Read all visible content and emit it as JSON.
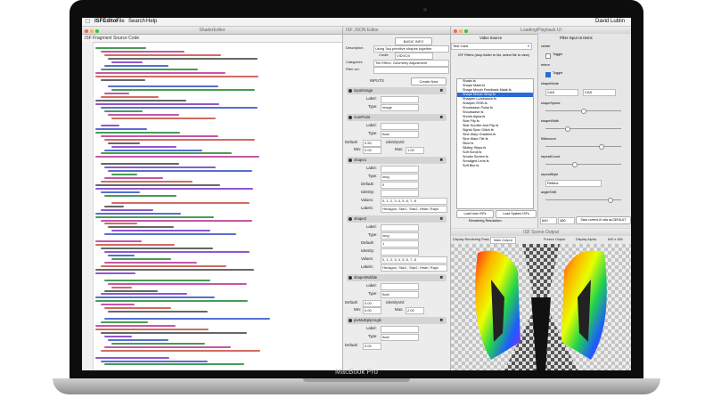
{
  "device": {
    "brand_label": "MacBook Pro"
  },
  "menubar": {
    "app": "ISFEditor",
    "items": [
      "File",
      "Search",
      "Help"
    ],
    "clock": "David Lublin"
  },
  "editor": {
    "window_title": "ShaderEditor",
    "header": "ISF Fragment Source Code"
  },
  "json_editor": {
    "header": "ISF JSON Editor",
    "basic_info_label": "BASIC INFO",
    "description_label": "Description:",
    "description_value": "Using 3sq primitive shapes together",
    "credit_label": "Credit:",
    "credit_value": "VIDVOX",
    "categories_label": "Categories:",
    "categories_value": "Tile Effect, Geometry Adjustment",
    "filter_version_label": "Filter ver:",
    "inputs_label": "INPUTS",
    "create_new_label": "Create New",
    "inputs": [
      {
        "name": "inputImage",
        "label_key": "Label:",
        "type_key": "Type:",
        "type_value": "image"
      },
      {
        "name": "numPoint",
        "label_key": "Label:",
        "type_key": "Type:",
        "type_value": "float",
        "default_key": "Default:",
        "default_value": "0.50",
        "min_key": "Min:",
        "min_value": "0.00",
        "max_key": "Max:",
        "max_value": "1.00",
        "identity_key": "IdentityVal:"
      },
      {
        "name": "shape1",
        "label_key": "Label:",
        "type_key": "Type:",
        "type_value": "long",
        "default_key": "Default:",
        "default_value": "0",
        "identity_key": "Identity:",
        "values_key": "Values:",
        "values_value": "0, 1, 2, 3, 4, 5, 6, 7, 8",
        "labels_key": "Labels:",
        "labels_value": "Hexagon, Star1, Star2, Heart, Rays"
      },
      {
        "name": "shape2",
        "label_key": "Label:",
        "type_key": "Type:",
        "type_value": "long",
        "default_key": "Default:",
        "default_value": "1",
        "identity_key": "Identity:",
        "values_key": "Values:",
        "values_value": "0, 1, 2, 3, 4, 5, 6, 7, 8",
        "labels_key": "Labels:",
        "labels_value": "Hexagon, Star1, Star2, Heart, Rays"
      },
      {
        "name": "shapeWobble",
        "label_key": "Label:",
        "type_key": "Type:",
        "type_value": "float",
        "default_key": "Default:",
        "default_value": "0.00",
        "min_key": "Min:",
        "min_value": "0.00",
        "max_key": "Max:",
        "max_value": "2.00",
        "identity_key": "IdentityVal:"
      },
      {
        "name": "pixMultiplyAngle",
        "label_key": "Label:",
        "type_key": "Type:",
        "type_value": "float",
        "default_key": "Default:",
        "default_value": "0.00"
      }
    ]
  },
  "loading": {
    "window_title": "Loading/Playback UI",
    "source_label": "Video Source",
    "source_select": "Test Card",
    "filter_ui_label": "Filter Input UI Items",
    "instructions": "ISF Filters (drop folder to list, select file to view)",
    "files": [
      "Shake.fs",
      "Shape Mask.fs",
      "Shape Morph Feedback Mask.fs",
      "Shape Morph Wrap.fs",
      "Sharpen Luminance.fs",
      "Sharpen RGB.fs",
      "Shockwave Pulse.fs",
      "Shockwave.fs",
      "Shrink Alpha.fs",
      "Side Flip.fs",
      "Side Scroller And Flip.fs",
      "Signal Sync Glitch.fs",
      "Sine Warp Gradient.fs",
      "Sine Warp Tile.fs",
      "Slice.fs",
      "Sliding Strips.fs",
      "Soft Scroll.fs",
      "Smoke Screen.fs",
      "Smudged Lens.fs",
      "Soft Blur.fs"
    ],
    "selected_index": 3,
    "load_user_label": "Load User ISFs",
    "load_system_label": "Load System ISFs",
    "rendering_resolution_label": "Rendering Resolution:",
    "res_w": "640",
    "res_h": "480",
    "save_default_label": "Save current UI vals as DEFAULT",
    "controls": [
      {
        "name": "center"
      },
      {
        "name": "Toggle",
        "kind": "checkbox"
      },
      {
        "name": "mirror"
      },
      {
        "name": "Toggle",
        "kind": "checkbox"
      },
      {
        "name": "shapeMode",
        "value": "CAS"
      },
      {
        "name": "shapeSpeed",
        "value": ""
      },
      {
        "name": "shapeWidth",
        "value": ""
      },
      {
        "name": "fillAmount",
        "value": ""
      },
      {
        "name": "repeatCount",
        "value": ""
      },
      {
        "name": "repeatStyle",
        "value": "Reflect"
      },
      {
        "name": "angleShift",
        "value": ""
      }
    ]
  },
  "output": {
    "window_title": "ISF Scene Output",
    "display_label": "Display Rendering Pass:",
    "pass_value": "Main Output",
    "freeze_label": "Freeze Output",
    "alpha_label": "Display Alpha",
    "size_label": "640 x 480"
  }
}
